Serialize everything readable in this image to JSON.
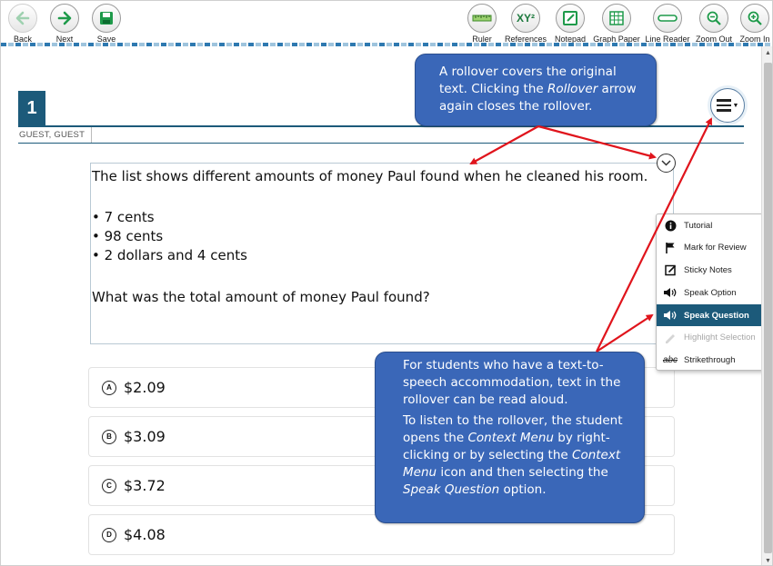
{
  "toolbar": {
    "left": [
      {
        "label": "Back",
        "icon": "back-arrow-icon"
      },
      {
        "label": "Next",
        "icon": "next-arrow-icon"
      },
      {
        "label": "Save",
        "icon": "save-disk-icon"
      }
    ],
    "right": [
      {
        "label": "Ruler",
        "icon": "ruler-icon"
      },
      {
        "label": "References",
        "icon": "references-icon",
        "glyph": "XY²"
      },
      {
        "label": "Notepad",
        "icon": "notepad-icon"
      },
      {
        "label": "Graph Paper",
        "icon": "graph-paper-icon"
      },
      {
        "label": "Line Reader",
        "icon": "line-reader-icon"
      },
      {
        "label": "Zoom Out",
        "icon": "zoom-out-icon"
      },
      {
        "label": "Zoom In",
        "icon": "zoom-in-icon"
      }
    ]
  },
  "question": {
    "number": "1",
    "student": "GUEST, GUEST"
  },
  "stimulus": {
    "intro": "The list shows different amounts of money Paul found when he cleaned his room.",
    "bullets": [
      "7 cents",
      "98 cents",
      "2 dollars and 4 cents"
    ],
    "question": "What was the total amount of money Paul found?"
  },
  "options": [
    {
      "letter": "A",
      "text": "$2.09"
    },
    {
      "letter": "B",
      "text": "$3.09"
    },
    {
      "letter": "C",
      "text": "$3.72"
    },
    {
      "letter": "D",
      "text": "$4.08"
    }
  ],
  "context_menu": {
    "items": [
      {
        "label": "Tutorial",
        "icon": "info-icon",
        "state": "normal"
      },
      {
        "label": "Mark for Review",
        "icon": "flag-icon",
        "state": "normal"
      },
      {
        "label": "Sticky Notes",
        "icon": "sticky-note-icon",
        "state": "normal"
      },
      {
        "label": "Speak Option",
        "icon": "speaker-icon",
        "state": "normal"
      },
      {
        "label": "Speak Question",
        "icon": "speaker-icon",
        "state": "active"
      },
      {
        "label": "Highlight Selection",
        "icon": "highlighter-icon",
        "state": "disabled"
      },
      {
        "label": "Strikethrough",
        "icon": "strikethrough-icon",
        "state": "normal"
      }
    ]
  },
  "callouts": {
    "rollover": {
      "line1": "A rollover covers the original",
      "line2_pre": "text. Clicking the",
      "line2_em": "Rollover",
      "line2_post": " arrow",
      "line3": "again closes the rollover."
    },
    "tts": {
      "p1": "For students who have a text-to-speech accommodation, text in the rollover can be read aloud.",
      "p2_a": "To listen to the rollover, the student opens the ",
      "p2_em1": "Context Menu",
      "p2_b": " by right-clicking or by selecting the ",
      "p2_em2": "Context Menu",
      "p2_c": " icon and then selecting the ",
      "p2_em3": "Speak Question",
      "p2_d": " option."
    }
  },
  "colors": {
    "header_blue": "#1c5a7a",
    "callout_blue": "#3a67b8",
    "arrow_red": "#e0141c",
    "menu_active": "#1c5a7a"
  }
}
